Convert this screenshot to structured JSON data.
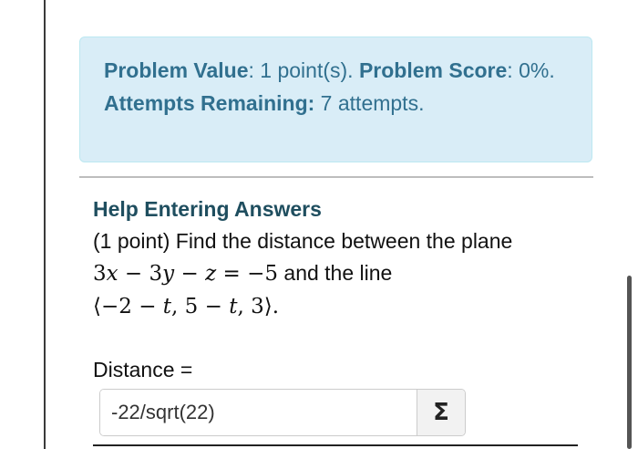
{
  "info": {
    "problem_value_label": "Problem Value",
    "problem_value_text": ": 1 point(s). ",
    "problem_score_label": "Problem Score",
    "problem_score_text": ": 0%. ",
    "attempts_label": "Attempts Remaining:",
    "attempts_text": " 7 attempts."
  },
  "problem": {
    "help_link": "Help Entering Answers",
    "intro": "(1 point) Find the distance between the plane",
    "equation": {
      "c1": "3",
      "v1": "x",
      "op1": " − ",
      "c2": "3",
      "v2": "y",
      "op2": " − ",
      "v3": "z",
      "op3": " = ",
      "rhs": "−5"
    },
    "and_the_line": " and the line",
    "line_vector": {
      "open": "⟨",
      "a": "−2",
      "m1": " − ",
      "t1": "t",
      "sep1": ", ",
      "b": "5",
      "m2": " − ",
      "t2": "t",
      "sep2": ", ",
      "c": "3",
      "close": "⟩",
      "end": "."
    }
  },
  "answer": {
    "label": "Distance =",
    "value": "-22/sqrt(22)",
    "equation_editor_symbol": "Σ"
  },
  "icons": {
    "equation_editor": "sigma-icon"
  }
}
